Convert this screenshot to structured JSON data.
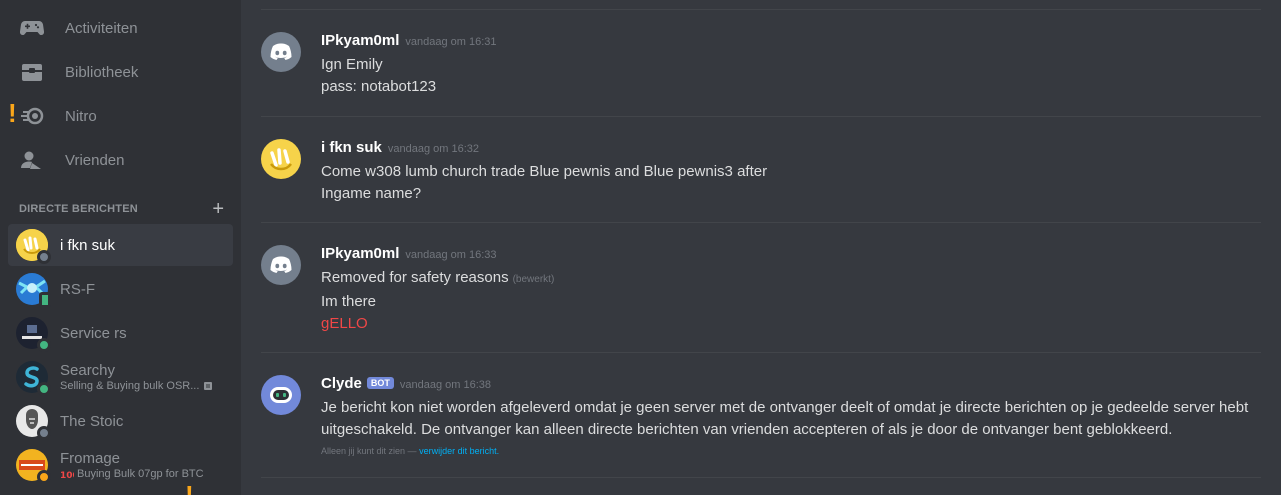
{
  "sidebar": {
    "nav": [
      {
        "label": "Activiteiten",
        "icon": "gamepad-icon"
      },
      {
        "label": "Bibliotheek",
        "icon": "library-icon"
      },
      {
        "label": "Nitro",
        "icon": "nitro-icon"
      },
      {
        "label": "Vrienden",
        "icon": "friends-icon"
      }
    ],
    "dm_header": "DIRECTE BERICHTEN",
    "dm_add": "+",
    "dms": [
      {
        "name": "i fkn suk",
        "sub": "",
        "status": "offline",
        "status_color": "#747f8d"
      },
      {
        "name": "RS-F",
        "sub": "",
        "status": "mobile",
        "status_color": "#43b581"
      },
      {
        "name": "Service rs",
        "sub": "",
        "status": "online",
        "status_color": "#43b581"
      },
      {
        "name": "Searchy",
        "sub": "Selling & Buying bulk OSR...",
        "status": "online",
        "status_color": "#43b581"
      },
      {
        "name": "The Stoic",
        "sub": "",
        "status": "offline",
        "status_color": "#747f8d"
      },
      {
        "name": "Fromage",
        "sub": "Buying Bulk 07gp for BTC",
        "status": "idle",
        "status_color": "#faa61a"
      }
    ]
  },
  "messages": [
    {
      "author": "IPkyam0ml",
      "timestamp": "vandaag om 16:31",
      "lines": [
        "Ign Emily",
        "pass: notabot123"
      ]
    },
    {
      "author": "i fkn suk",
      "timestamp": "vandaag om 16:32",
      "lines": [
        "Come w308 lumb church trade Blue pewnis and Blue pewnis3 after",
        "Ingame name?"
      ]
    },
    {
      "author": "IPkyam0ml",
      "timestamp": "vandaag om 16:33",
      "line1": "Removed for safety reasons",
      "edited": "(bewerkt)",
      "line2": "Im there",
      "line3": "gELLO"
    },
    {
      "author": "Clyde",
      "bot_tag": "BOT",
      "timestamp": "vandaag om 16:38",
      "lines": [
        "Je bericht kon niet worden afgeleverd omdat je geen server met de ontvanger deelt of omdat je directe berichten op je gedeelde server hebt",
        "uitgeschakeld. De ontvanger kan alleen directe berichten van vrienden accepteren of als je door de ontvanger bent geblokkeerd."
      ],
      "note": "Alleen jij kunt dit zien —",
      "note_link": "verwijder dit bericht."
    }
  ],
  "colors": {
    "accent": "#7289da",
    "discord_blurple": "#7289da",
    "warning": "#faa61a",
    "danger": "#f04747",
    "link": "#00b0f4"
  }
}
